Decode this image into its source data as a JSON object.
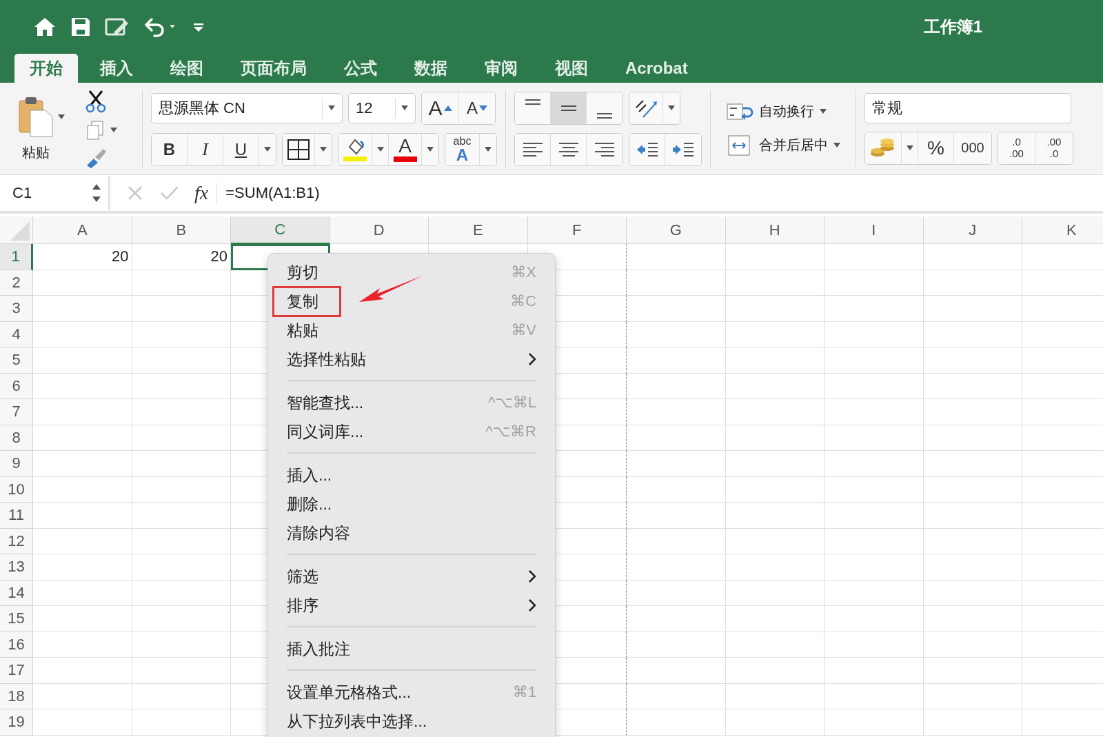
{
  "title_bar": {
    "title": "工作簿1"
  },
  "tabs": [
    {
      "label": "开始",
      "selected": true
    },
    {
      "label": "插入",
      "selected": false
    },
    {
      "label": "绘图",
      "selected": false
    },
    {
      "label": "页面布局",
      "selected": false
    },
    {
      "label": "公式",
      "selected": false
    },
    {
      "label": "数据",
      "selected": false
    },
    {
      "label": "审阅",
      "selected": false
    },
    {
      "label": "视图",
      "selected": false
    },
    {
      "label": "Acrobat",
      "selected": false
    }
  ],
  "ribbon": {
    "paste_label": "粘贴",
    "font_name": "思源黑体 CN",
    "font_size": "12",
    "grow_letter": "A",
    "shrink_letter": "A",
    "bold": "B",
    "italic": "I",
    "underline": "U",
    "font_color_letter": "A",
    "spell_small": "abc",
    "spell_letter": "A",
    "vertical_align": [
      {
        "selected": false
      },
      {
        "selected": true
      },
      {
        "selected": false
      }
    ],
    "wrap_text": "自动换行",
    "merge_center": "合并后居中",
    "number_format": "常规",
    "percent": "%",
    "thousands": "000",
    "decimal_top": ".0",
    "decimal_bottom": ".00",
    "decimal_top_2": ".00",
    "decimal_bottom_2": ".0"
  },
  "formula_bar": {
    "name_box": "C1",
    "fx": "fx",
    "formula": "=SUM(A1:B1)"
  },
  "sheet": {
    "columns": [
      {
        "label": "A",
        "selected": false
      },
      {
        "label": "B",
        "selected": false
      },
      {
        "label": "C",
        "selected": true
      },
      {
        "label": "D",
        "selected": false
      },
      {
        "label": "E",
        "selected": false
      },
      {
        "label": "F",
        "selected": false
      },
      {
        "label": "G",
        "selected": false
      },
      {
        "label": "H",
        "selected": false
      },
      {
        "label": "I",
        "selected": false
      },
      {
        "label": "J",
        "selected": false
      },
      {
        "label": "K",
        "selected": false
      }
    ],
    "rows": [
      {
        "label": "1",
        "selected": true,
        "cells": [
          "20",
          "20"
        ]
      },
      {
        "label": "2",
        "selected": false,
        "cells": []
      },
      {
        "label": "3",
        "selected": false,
        "cells": []
      },
      {
        "label": "4",
        "selected": false,
        "cells": []
      },
      {
        "label": "5",
        "selected": false,
        "cells": []
      },
      {
        "label": "6",
        "selected": false,
        "cells": []
      },
      {
        "label": "7",
        "selected": false,
        "cells": []
      },
      {
        "label": "8",
        "selected": false,
        "cells": []
      },
      {
        "label": "9",
        "selected": false,
        "cells": []
      },
      {
        "label": "10",
        "selected": false,
        "cells": []
      },
      {
        "label": "11",
        "selected": false,
        "cells": []
      },
      {
        "label": "12",
        "selected": false,
        "cells": []
      },
      {
        "label": "13",
        "selected": false,
        "cells": []
      },
      {
        "label": "14",
        "selected": false,
        "cells": []
      },
      {
        "label": "15",
        "selected": false,
        "cells": []
      },
      {
        "label": "16",
        "selected": false,
        "cells": []
      },
      {
        "label": "17",
        "selected": false,
        "cells": []
      },
      {
        "label": "18",
        "selected": false,
        "cells": []
      },
      {
        "label": "19",
        "selected": false,
        "cells": []
      }
    ]
  },
  "context_menu": {
    "groups": [
      [
        {
          "label": "剪切",
          "shortcut": "⌘X",
          "submenu": false,
          "boxed": false
        },
        {
          "label": "复制",
          "shortcut": "⌘C",
          "submenu": false,
          "boxed": true
        },
        {
          "label": "粘贴",
          "shortcut": "⌘V",
          "submenu": false,
          "boxed": false
        },
        {
          "label": "选择性粘贴",
          "submenu": true,
          "boxed": false
        }
      ],
      [
        {
          "label": "智能查找...",
          "shortcut": "^⌥⌘L",
          "submenu": false,
          "boxed": false
        },
        {
          "label": "同义词库...",
          "shortcut": "^⌥⌘R",
          "submenu": false,
          "boxed": false
        }
      ],
      [
        {
          "label": "插入...",
          "submenu": false,
          "boxed": false
        },
        {
          "label": "删除...",
          "submenu": false,
          "boxed": false
        },
        {
          "label": "清除内容",
          "submenu": false,
          "boxed": false
        }
      ],
      [
        {
          "label": "筛选",
          "submenu": true,
          "boxed": false
        },
        {
          "label": "排序",
          "submenu": true,
          "boxed": false
        }
      ],
      [
        {
          "label": "插入批注",
          "submenu": false,
          "boxed": false
        }
      ],
      [
        {
          "label": "设置单元格格式...",
          "shortcut": "⌘1",
          "submenu": false,
          "boxed": false
        },
        {
          "label": "从下拉列表中选择...",
          "submenu": false,
          "boxed": false
        }
      ]
    ]
  }
}
